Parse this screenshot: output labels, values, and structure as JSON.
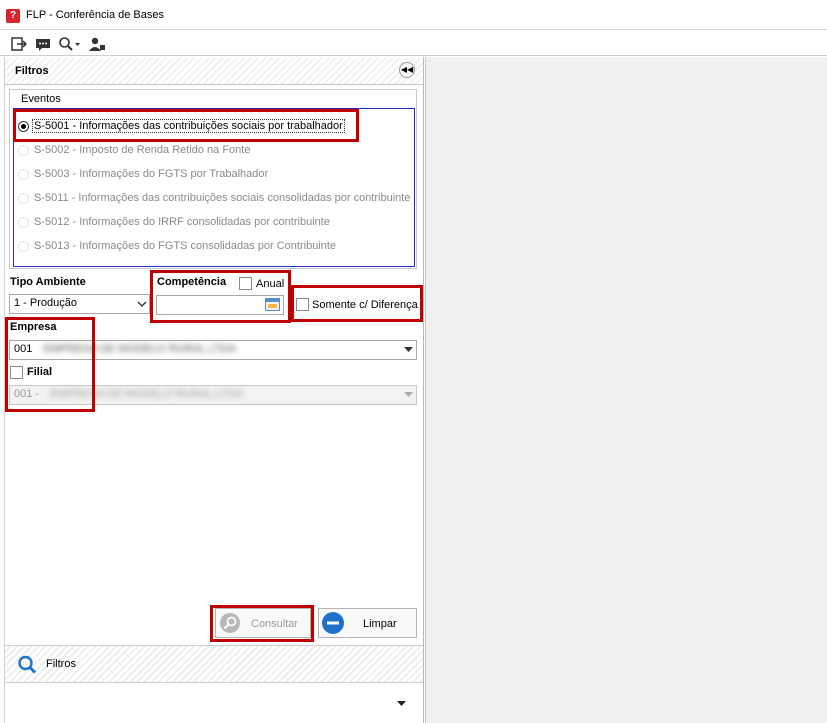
{
  "window": {
    "title": "FLP - Conferência de Bases",
    "app_icon_glyph": "?"
  },
  "toolbar": {
    "icons": [
      "exit-icon",
      "chat-icon",
      "search-dropdown-icon",
      "user-icon"
    ]
  },
  "filters_panel": {
    "header": "Filtros",
    "collapse_glyph": "◀◀",
    "eventos": {
      "label": "Eventos",
      "options": [
        {
          "label": "S-5001 - Informações das contribuições sociais por trabalhador",
          "selected": true
        },
        {
          "label": "S-5002 - Imposto de Renda Retido na Fonte",
          "selected": false
        },
        {
          "label": "S-5003 - Informações do FGTS por Trabalhador",
          "selected": false
        },
        {
          "label": "S-5011 - Informações das contribuições sociais consolidadas por contribuinte",
          "selected": false
        },
        {
          "label": "S-5012 - Informações do IRRF consolidadas por contribuinte",
          "selected": false
        },
        {
          "label": "S-5013 - Informações do FGTS consolidadas por Contribuinte",
          "selected": false
        }
      ]
    },
    "tipo_ambiente": {
      "label": "Tipo Ambiente",
      "value": "1 - Produção"
    },
    "competencia": {
      "label": "Competência",
      "anual_label": "Anual",
      "value": ""
    },
    "somente_diferenca": {
      "label": "Somente c/ Diferença"
    },
    "empresa": {
      "label": "Empresa",
      "code": "001",
      "name": "EMPRESA DE MODELO RURAL LTDA"
    },
    "filial": {
      "label": "Filial",
      "code": "001 -",
      "name": "EMPRESA DE MODELO RURAL LTDA"
    },
    "buttons": {
      "consultar": "Consultar",
      "limpar": "Limpar"
    },
    "bottom_tab": {
      "label": "Filtros"
    }
  },
  "colors": {
    "highlight": "#c00000",
    "selection_border": "#2b2bb8",
    "limpar_icon": "#1e72c8"
  }
}
